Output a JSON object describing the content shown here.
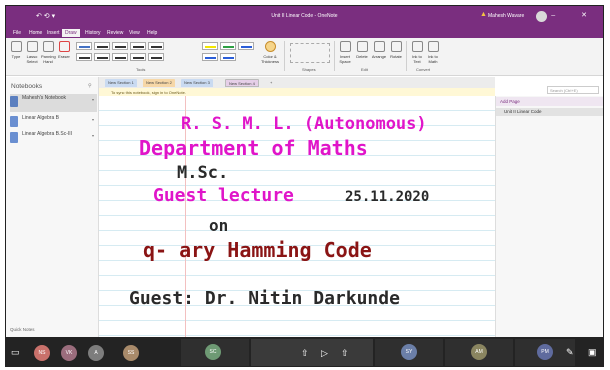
{
  "window": {
    "title": "Unit II Linear Code - OneNote",
    "user_name": "Mahesh Wavare",
    "window_controls": [
      "minimize-icon",
      "close-icon"
    ]
  },
  "ribbon": {
    "tabs": [
      "File",
      "Home",
      "Insert",
      "Draw",
      "History",
      "Review",
      "View",
      "Help"
    ],
    "active_tab": "Draw",
    "buttons": {
      "type": "Type",
      "lasso": "Lasso Select",
      "panning": "Panning Hand",
      "eraser": "Eraser",
      "color_thickness": "Color & Thickness",
      "insert_space": "Insert Space",
      "delete": "Delete",
      "arrange": "Arrange",
      "rotate": "Rotate",
      "ink_to_text": "Ink to Text",
      "ink_to_math": "Ink to Math"
    },
    "groups": {
      "tools": "Tools",
      "shapes": "Shapes",
      "edit": "Edit",
      "convert": "Convert"
    },
    "pen_colors": [
      "#4472c4",
      "#333333",
      "#333333",
      "#333333",
      "#333333",
      "#f2e600",
      "#2ea043",
      "#2b5ed8"
    ]
  },
  "nav": {
    "header": "Notebooks",
    "notebooks": [
      {
        "label": "Mahesh's Notebook",
        "color": "#5b7fbf"
      },
      {
        "label": "Linear Algebra B",
        "color": "#6a8fd1"
      },
      {
        "label": "Linear Algebra B.Sc-III",
        "color": "#6a8fd1"
      }
    ],
    "quick_notes": "Quick Notes"
  },
  "sections": {
    "tabs": [
      {
        "label": "New Section 1",
        "color": "#c9daf1"
      },
      {
        "label": "New Section 2",
        "color": "#f6d7a7"
      },
      {
        "label": "New Section 3",
        "color": "#c9daf1"
      },
      {
        "label": "New Section 4",
        "color": "#e6cfe8"
      }
    ],
    "add_tab": "+",
    "sync_message": "To sync this notebook, sign in to OneNote."
  },
  "ink": {
    "line1": "R. S. M. L. (Autonomous)",
    "line2": "Department of Maths",
    "line3": "M.Sc.",
    "line4": "Guest lecture",
    "date": "25.11.2020",
    "line5": "on",
    "line6": "q- ary Hamming Code",
    "line7": "Guest: Dr. Nitin Darkunde",
    "colors": {
      "magenta": "#e015c9",
      "dark": "#2a2a2a",
      "maroon": "#8a1414"
    }
  },
  "pages": {
    "search_placeholder": "Search (Ctrl+E)",
    "add_page": "Add Page",
    "page_title": "Unit II Linear Code"
  },
  "meeting": {
    "participants": [
      {
        "initials": "NS",
        "color": "#c9716b"
      },
      {
        "initials": "VK",
        "color": "#9b6d7d"
      },
      {
        "initials": "A",
        "color": "#7d7d7d"
      },
      {
        "initials": "SS",
        "color": "#a88a6a"
      },
      {
        "initials": "SC",
        "color": "#6e9a74"
      },
      {
        "initials": "SY",
        "color": "#6b7fa8"
      },
      {
        "initials": "AM",
        "color": "#8a8560"
      },
      {
        "initials": "PM",
        "color": "#5f6b9e"
      }
    ]
  }
}
